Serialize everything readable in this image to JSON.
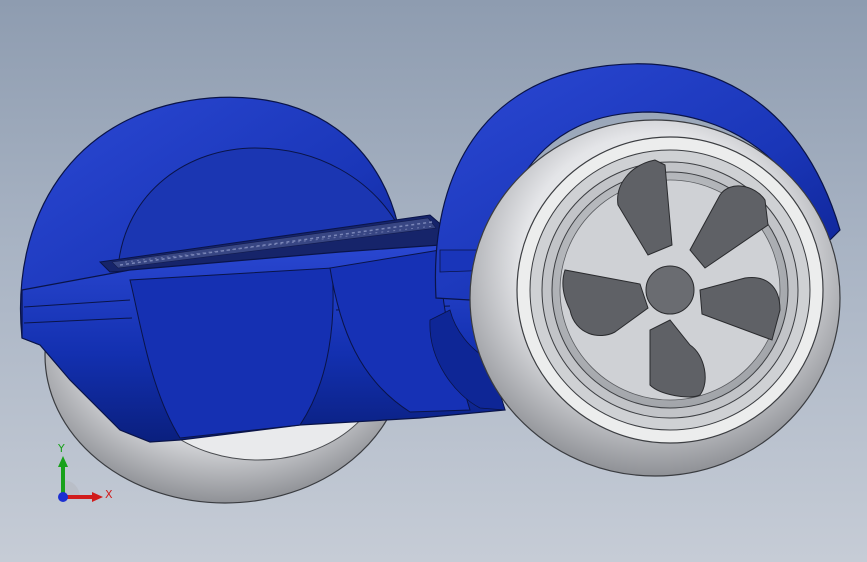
{
  "viewport": {
    "model": "hoverboard-3d-model",
    "colors": {
      "background_top": "#8e9cb0",
      "background_bottom": "#c6ccd6",
      "body_blue": "#1a36b8",
      "body_blue_dark": "#0a1f7e",
      "tire_gray": "#e6e7e9",
      "rim_gray": "#b9bcc1",
      "spoke_dark": "#5f6166"
    }
  },
  "triad": {
    "x_label": "X",
    "y_label": "Y",
    "x_color": "#d11c1c",
    "y_color": "#18a11a",
    "z_color": "#1b2fd1"
  }
}
